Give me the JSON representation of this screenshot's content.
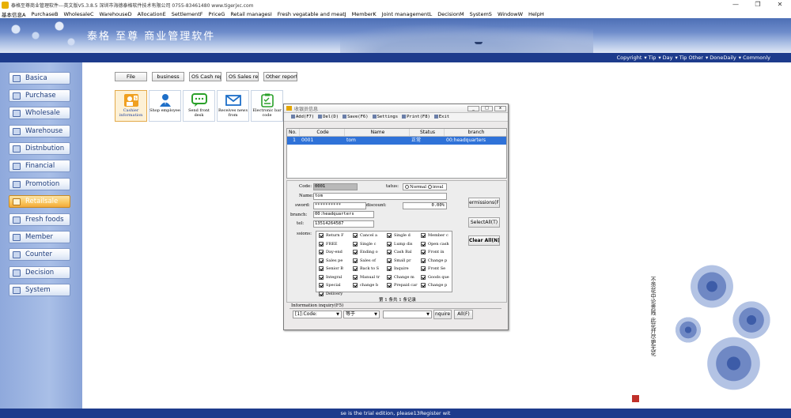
{
  "window": {
    "title": "泰格至尊商业管理软件---英文版V5.3.8.5   深圳市海德泰格软件技术有限公司   0755-83461480   www.tigerjxc.com",
    "controls": [
      "—",
      "❐",
      "✕"
    ]
  },
  "menu": [
    "基本信息A",
    "PurchaseB",
    "WholesaleC",
    "WarehouseD",
    "AllocationE",
    "SettlementF",
    "PriceG",
    "Retail managesI",
    "Fresh vegatable and meatJ",
    "MemberK",
    "Joint managementL",
    "DecisionM",
    "SystemS",
    "WindowW",
    "HelpH"
  ],
  "banner": {
    "logo": "泰格 至尊 商业管理软件"
  },
  "topnav": [
    "Copyright",
    "Tip",
    "Day",
    "Tip Other",
    "DoneDaily",
    "Commonly"
  ],
  "sidebar": [
    {
      "label": "Basica",
      "active": false
    },
    {
      "label": "Purchase",
      "active": false
    },
    {
      "label": "Wholesale",
      "active": false
    },
    {
      "label": "Warehouse",
      "active": false
    },
    {
      "label": "Distnbution",
      "active": false
    },
    {
      "label": "Financial",
      "active": false
    },
    {
      "label": "Promotion",
      "active": false
    },
    {
      "label": "Retailsale",
      "active": true
    },
    {
      "label": "Fresh foods",
      "active": false
    },
    {
      "label": "Member",
      "active": false
    },
    {
      "label": "Counter",
      "active": false
    },
    {
      "label": "Decision",
      "active": false
    },
    {
      "label": "System",
      "active": false
    }
  ],
  "tabs": [
    "File",
    "business",
    "OS Cash repo",
    "OS Sales repo",
    "Other reports"
  ],
  "tiles": [
    {
      "label": "Cashier information",
      "icon": "cashier-icon",
      "active": true
    },
    {
      "label": "Shop employee",
      "icon": "employee-icon",
      "active": false
    },
    {
      "label": "Send front desk",
      "icon": "message-icon",
      "active": false
    },
    {
      "label": "Receives news from",
      "icon": "mail-icon",
      "active": false
    },
    {
      "label": "Electronic bar code",
      "icon": "barcode-list-icon",
      "active": false
    }
  ],
  "painting": {
    "calligraphy": "不羡花中论贵贱 此花开尽更无花"
  },
  "dialog": {
    "title": "收银员信息",
    "toolbar": [
      "Add(F7)",
      "Del(D)",
      "Save(F6)",
      "Settings",
      "Print(F8)",
      "Exit"
    ],
    "grid": {
      "columns": [
        "No.",
        "Code",
        "Name",
        "Status",
        "branch"
      ],
      "rows": [
        {
          "no": "1",
          "code": "0001",
          "name": "tom",
          "status": "正常",
          "branch": "00:headquarters"
        }
      ]
    },
    "form": {
      "code_label": "Code:",
      "code_value": "0001",
      "status_label": "tatus:",
      "status_normal": "Normal",
      "status_invalid": "inval",
      "name_label": "Name:",
      "name_value": "tom",
      "password_label": "sword:",
      "password_value": "**********",
      "discount_label": "discount:",
      "discount_value": "0.00%",
      "branch_label": "branch:",
      "branch_value": "00:headquarters",
      "tel_label": "tel:",
      "tel_value": "13514264587",
      "permissions_label": "ssions:",
      "permissions_button": "ermissions(F",
      "select_all_button": "SelectAll(T)",
      "clear_all_button": "Clear All(N)",
      "permissions": [
        "Return F",
        "Cancel a",
        "Single d",
        "Member c",
        "FREE",
        "Single c",
        "Lump dis",
        "Open cash",
        "Day-end",
        "Ending o",
        "Cash Bal",
        "Front in",
        "Sales pe",
        "Sales of",
        "Small pr",
        "Change p",
        "Senior B",
        "Back to S",
        "Inquire",
        "Front Se",
        "Integral",
        "Manual tr",
        "Change m",
        "Goods que",
        "Special",
        "change b",
        "Prepaid car",
        "Change p",
        "Delivery"
      ],
      "pager": "第 1 条共 1 条记录"
    },
    "query": {
      "title": "Information inquiry(F5)",
      "field": "[1]:Code:",
      "operator": "等于",
      "value": "",
      "inquire_button": "nquire",
      "all_button": "All(F)"
    }
  },
  "statusbar": "se is the trial edition, please13Register wit"
}
